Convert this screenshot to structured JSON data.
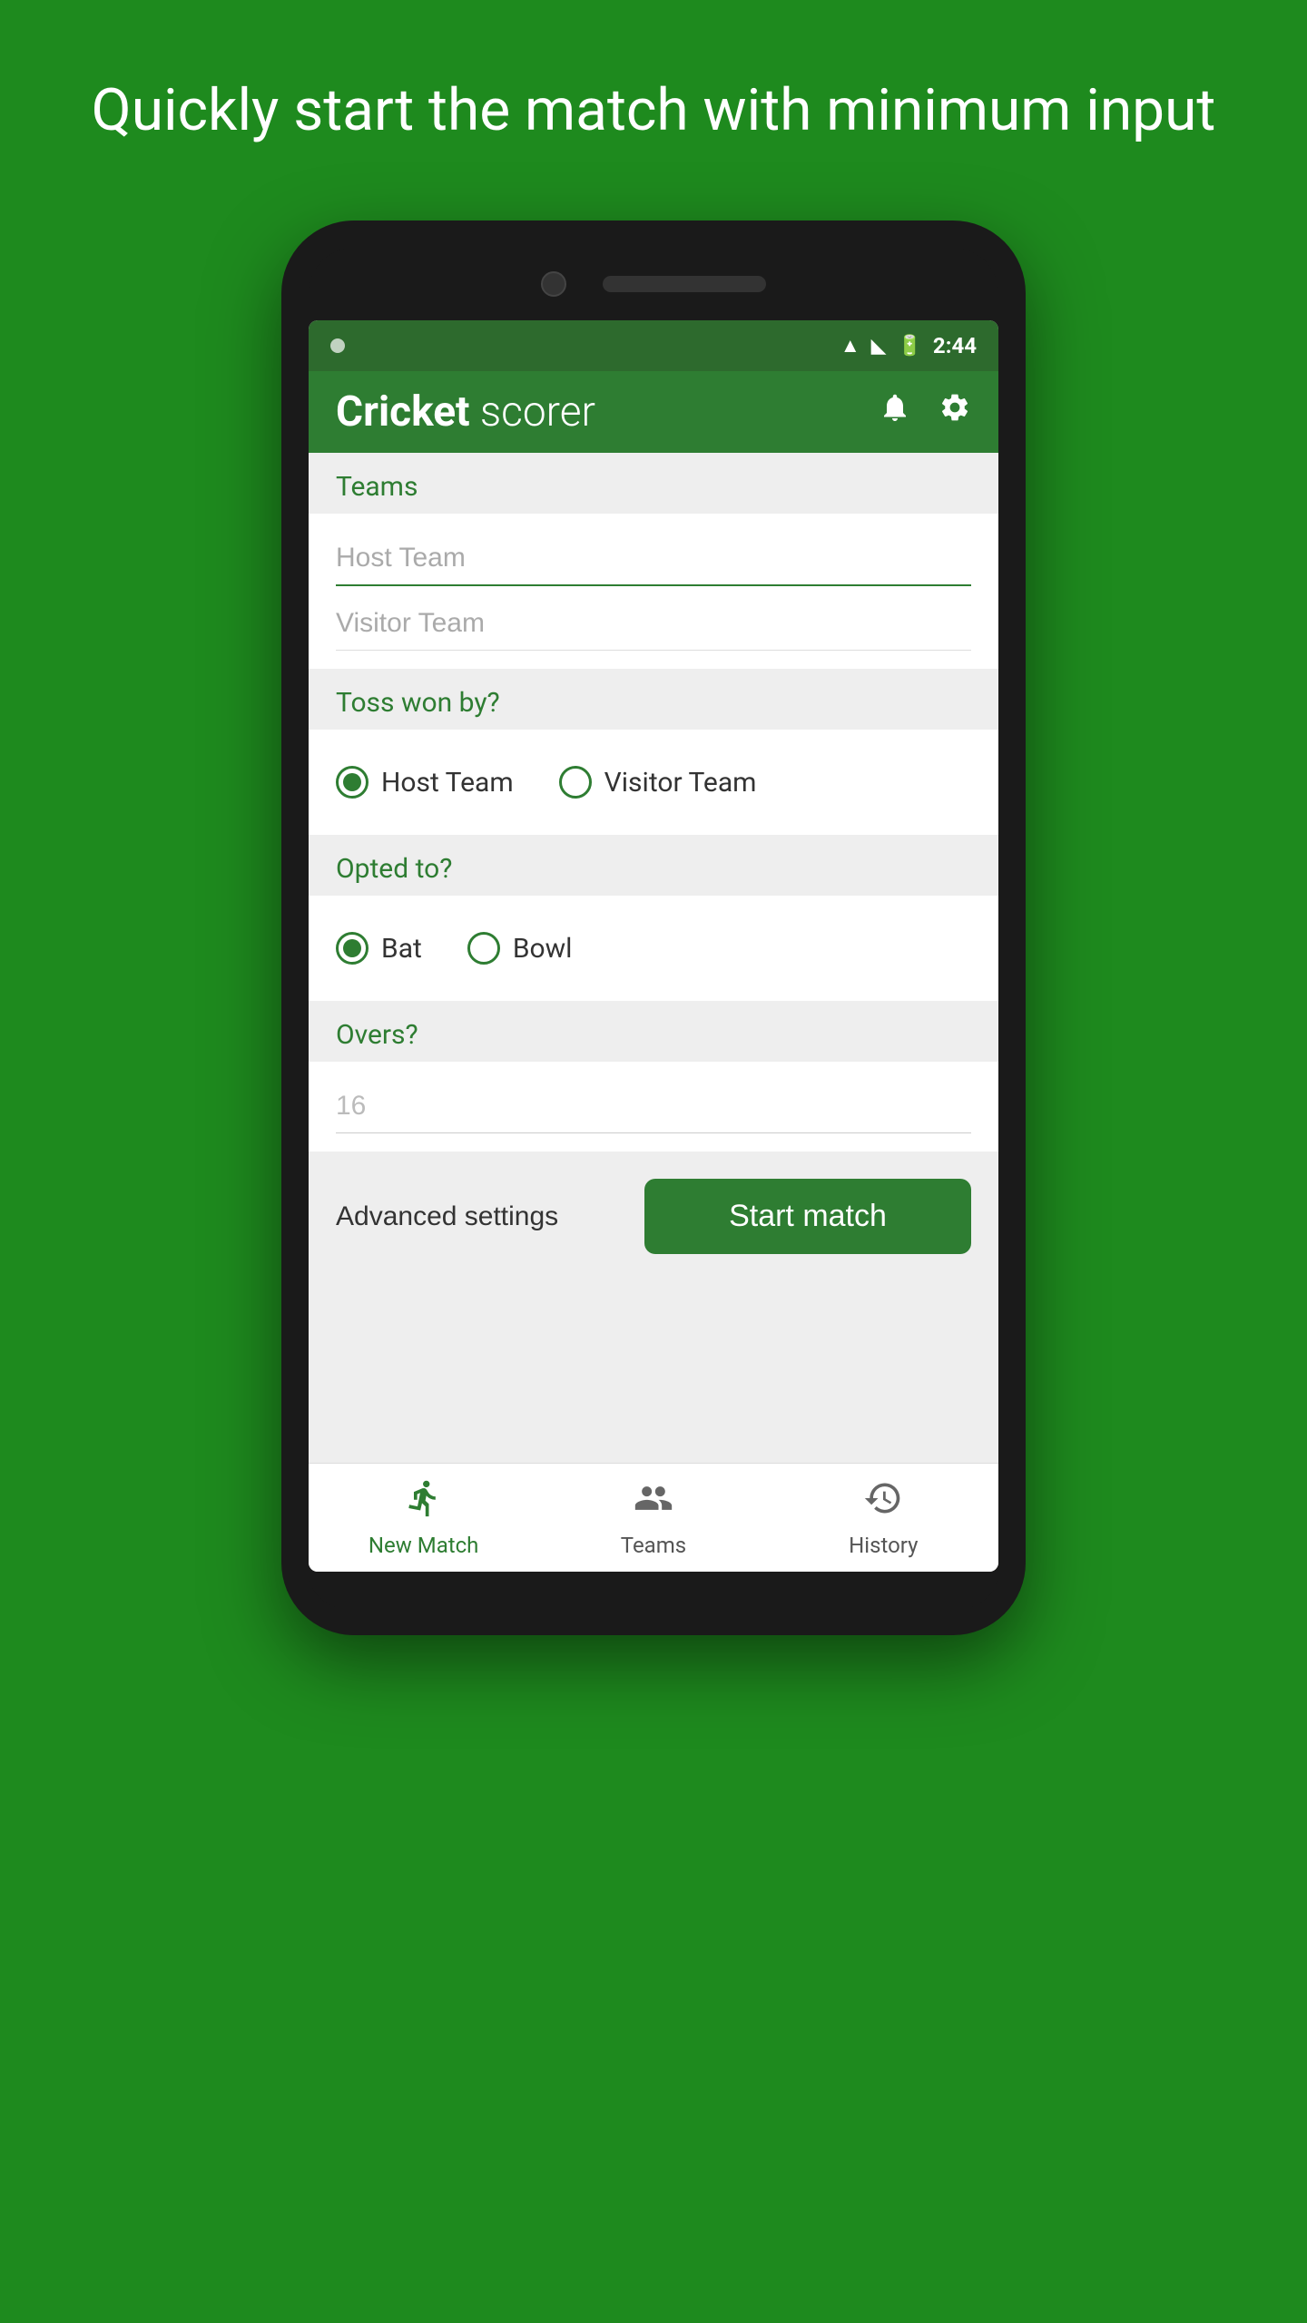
{
  "promo": {
    "text": "Quickly start the match with minimum input"
  },
  "status_bar": {
    "time": "2:44"
  },
  "app_bar": {
    "title_bold": "Cricket",
    "title_light": " scorer",
    "notification_icon": "bell-icon",
    "settings_icon": "gear-icon"
  },
  "teams_section": {
    "label": "Teams",
    "host_placeholder": "Host Team",
    "visitor_placeholder": "Visitor Team"
  },
  "toss_section": {
    "label": "Toss won by?",
    "options": [
      "Host Team",
      "Visitor Team"
    ],
    "selected": "Host Team"
  },
  "opted_section": {
    "label": "Opted to?",
    "options": [
      "Bat",
      "Bowl"
    ],
    "selected": "Bat"
  },
  "overs_section": {
    "label": "Overs?",
    "value": "16"
  },
  "actions": {
    "advanced_label": "Advanced settings",
    "start_label": "Start match"
  },
  "bottom_nav": {
    "items": [
      {
        "id": "new-match",
        "label": "New Match",
        "active": true
      },
      {
        "id": "teams",
        "label": "Teams",
        "active": false
      },
      {
        "id": "history",
        "label": "History",
        "active": false
      }
    ]
  }
}
